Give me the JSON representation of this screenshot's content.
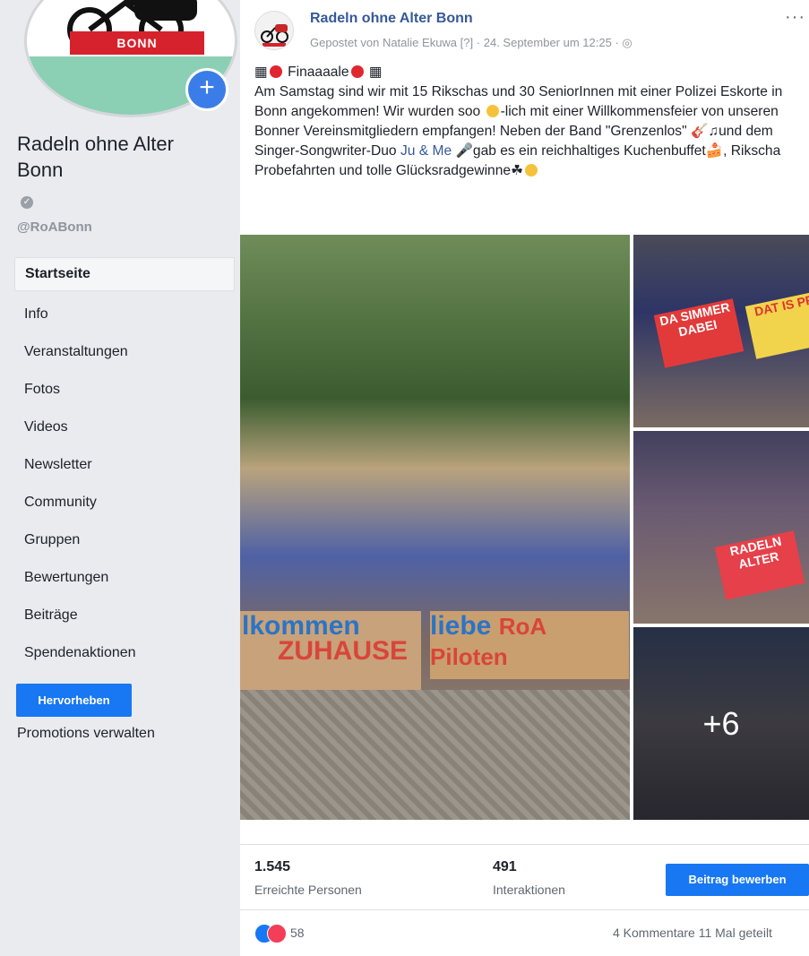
{
  "page": {
    "name": "Radeln ohne Alter Bonn",
    "handle": "@RoABonn",
    "logo_text": "BONN"
  },
  "nav": {
    "items": [
      {
        "label": "Startseite"
      },
      {
        "label": "Info"
      },
      {
        "label": "Veranstaltungen"
      },
      {
        "label": "Fotos"
      },
      {
        "label": "Videos"
      },
      {
        "label": "Newsletter"
      },
      {
        "label": "Community"
      },
      {
        "label": "Gruppen"
      },
      {
        "label": "Bewertungen"
      },
      {
        "label": "Beiträge"
      },
      {
        "label": "Spendenaktionen"
      }
    ],
    "highlight_button": "Hervorheben",
    "promotions_link": "Promotions verwalten"
  },
  "post": {
    "author": "Radeln ohne Alter Bonn",
    "posted_by": "Gepostet von Natalie Ekuwa",
    "posted_by_marker": "[?]",
    "timestamp": "24. September um 12:25",
    "line1": "Finaaaale",
    "body_a": "Am Samstag sind wir mit 15 Rikschas und 30 SeniorInnen mit einer Polizei Eskorte in Bonn angekommen! Wir wurden soo ",
    "body_b": "-lich mit einer Willkommensfeier von unseren Bonner Vereinsmitgliedern empfangen! Neben der Band \"Grenzenlos\" ",
    "body_c": "und dem Singer-Songwriter-Duo ",
    "body_tag": "Ju & Me",
    "body_d": "gab es ein reichhaltiges Kuchenbuffet",
    "body_e": ", Rikscha Probefahrten und tolle Glücksradgewinne",
    "photo_more": "+6",
    "sign_left_a": "lkommen",
    "sign_left_b": "ZUHAUSE",
    "sign_right_a": "liebe",
    "sign_right_b": "RoA Piloten",
    "sign_small_1": "DA SIMMER DABEI",
    "sign_small_2": "DAT IS PRI",
    "sign_small_3": "RADELN ALTER"
  },
  "stats": {
    "reach_value": "1.545",
    "reach_label": "Erreichte Personen",
    "interactions_value": "491",
    "interactions_label": "Interaktionen",
    "boost_button": "Beitrag bewerben"
  },
  "footer": {
    "reaction_count": "58",
    "comments": "4 Kommentare",
    "shares": "11 Mal geteilt"
  },
  "colors": {
    "link_blue": "#365899",
    "button_blue": "#1877f2"
  }
}
